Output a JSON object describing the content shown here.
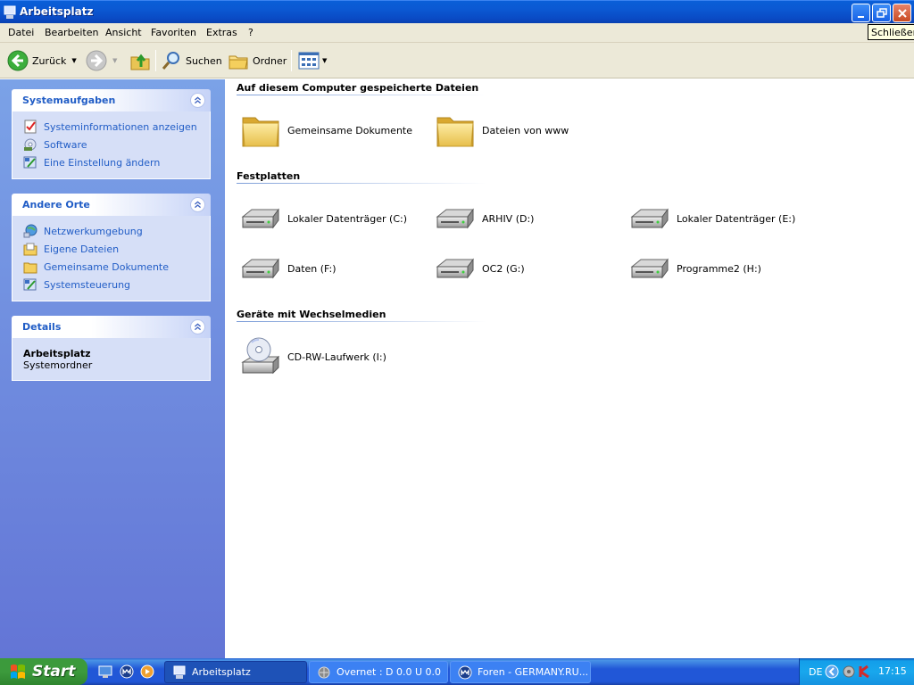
{
  "window": {
    "title": "Arbeitsplatz",
    "close_tooltip": "Schließen"
  },
  "menu": [
    "Datei",
    "Bearbeiten",
    "Ansicht",
    "Favoriten",
    "Extras",
    "?"
  ],
  "toolbar": {
    "back_label": "Zurück",
    "search_label": "Suchen",
    "folders_label": "Ordner"
  },
  "sidebar": {
    "system_tasks": {
      "title": "Systemaufgaben",
      "items": [
        "Systeminformationen anzeigen",
        "Software",
        "Eine Einstellung ändern"
      ]
    },
    "other_places": {
      "title": "Andere Orte",
      "items": [
        "Netzwerkumgebung",
        "Eigene Dateien",
        "Gemeinsame Dokumente",
        "Systemsteuerung"
      ]
    },
    "details": {
      "title": "Details",
      "name": "Arbeitsplatz",
      "type": "Systemordner"
    }
  },
  "groups": {
    "stored_files": {
      "title": "Auf diesem Computer gespeicherte Dateien",
      "items": [
        "Gemeinsame Dokumente",
        "Dateien von www"
      ]
    },
    "hard_disks": {
      "title": "Festplatten",
      "items": [
        "Lokaler Datenträger (C:)",
        "ARHIV (D:)",
        "Lokaler Datenträger (E:)",
        "Daten (F:)",
        "OC2 (G:)",
        "Programme2 (H:)"
      ]
    },
    "removable": {
      "title": "Geräte mit Wechselmedien",
      "items": [
        "CD-RW-Laufwerk (I:)"
      ]
    }
  },
  "taskbar": {
    "start_label": "Start",
    "tasks": [
      "Arbeitsplatz",
      "Overnet : D 0.0 U 0.0",
      "Foren - GERMANY.RU..."
    ],
    "language": "DE",
    "clock": "17:15"
  },
  "colors": {
    "titlebar": "#0a58d2",
    "task_link": "#215dc6",
    "sidebar_top": "#7ba2e7",
    "sidebar_bottom": "#6375d6",
    "start_green": "#3c9a3c"
  }
}
